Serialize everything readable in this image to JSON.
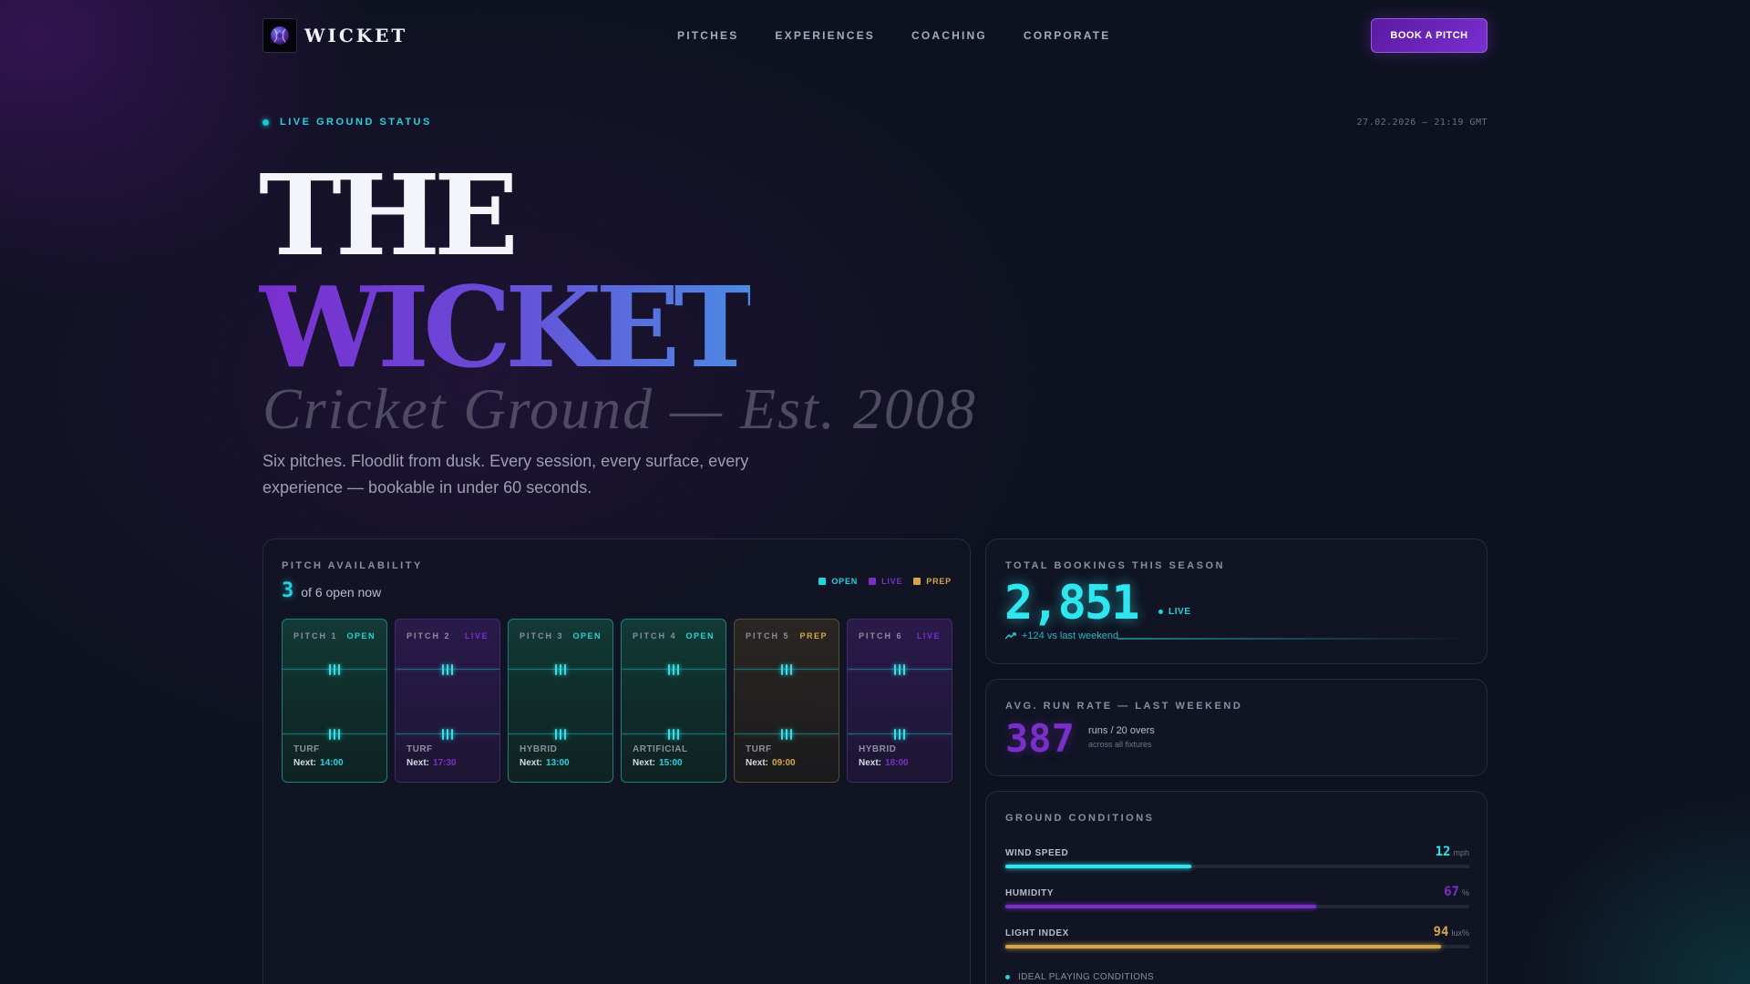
{
  "nav": {
    "brand": "WICKET",
    "links": [
      "PITCHES",
      "EXPERIENCES",
      "COACHING",
      "CORPORATE"
    ],
    "cta": "BOOK A PITCH"
  },
  "status": {
    "label": "LIVE GROUND STATUS",
    "timestamp": "27.02.2026 — 21:19 GMT"
  },
  "hero": {
    "line1": "THE",
    "line2": "WICKET",
    "subtitle": "Cricket Ground — Est. 2008",
    "description": "Six pitches. Floodlit from dusk. Every session, every surface, every experience — bookable in under 60 seconds."
  },
  "availability": {
    "label": "PITCH AVAILABILITY",
    "open_count": "3",
    "open_suffix": "of 6 open now",
    "legend": [
      {
        "label": "OPEN",
        "color": "#22d3e0"
      },
      {
        "label": "LIVE",
        "color": "#7a2fc8"
      },
      {
        "label": "PREP",
        "color": "#d4a64a"
      }
    ],
    "next_label": "Next:",
    "pitches": [
      {
        "name": "PITCH 1",
        "status": "OPEN",
        "kind": "open",
        "surface": "TURF",
        "next": "14:00"
      },
      {
        "name": "PITCH 2",
        "status": "LIVE",
        "kind": "live",
        "surface": "TURF",
        "next": "17:30"
      },
      {
        "name": "PITCH 3",
        "status": "OPEN",
        "kind": "open",
        "surface": "HYBRID",
        "next": "13:00"
      },
      {
        "name": "PITCH 4",
        "status": "OPEN",
        "kind": "open",
        "surface": "ARTIFICIAL",
        "next": "15:00"
      },
      {
        "name": "PITCH 5",
        "status": "PREP",
        "kind": "prep",
        "surface": "TURF",
        "next": "09:00"
      },
      {
        "name": "PITCH 6",
        "status": "LIVE",
        "kind": "live",
        "surface": "HYBRID",
        "next": "18:00"
      }
    ],
    "colors": {
      "open": "#22d3e0",
      "live": "#7a2fc8",
      "prep": "#d4a64a"
    }
  },
  "bookings": {
    "label": "TOTAL BOOKINGS THIS SEASON",
    "value": "2,851",
    "live": "LIVE",
    "delta": "+124 vs last weekend"
  },
  "run_rate": {
    "label": "AVG. RUN RATE — LAST WEEKEND",
    "value": "387",
    "unit": "runs / 20 overs",
    "sub": "across all fixtures"
  },
  "conditions": {
    "label": "GROUND CONDITIONS",
    "metrics": [
      {
        "name": "WIND SPEED",
        "value": "12",
        "unit": "mph",
        "level": 0.4,
        "color": "#2ee6f0"
      },
      {
        "name": "HUMIDITY",
        "value": "67",
        "unit": "%",
        "level": 0.67,
        "color": "#7a2fc8"
      },
      {
        "name": "LIGHT INDEX",
        "value": "94",
        "unit": "lux%",
        "level": 0.94,
        "color": "#d4a64a"
      }
    ],
    "footer": "IDEAL PLAYING CONDITIONS"
  }
}
